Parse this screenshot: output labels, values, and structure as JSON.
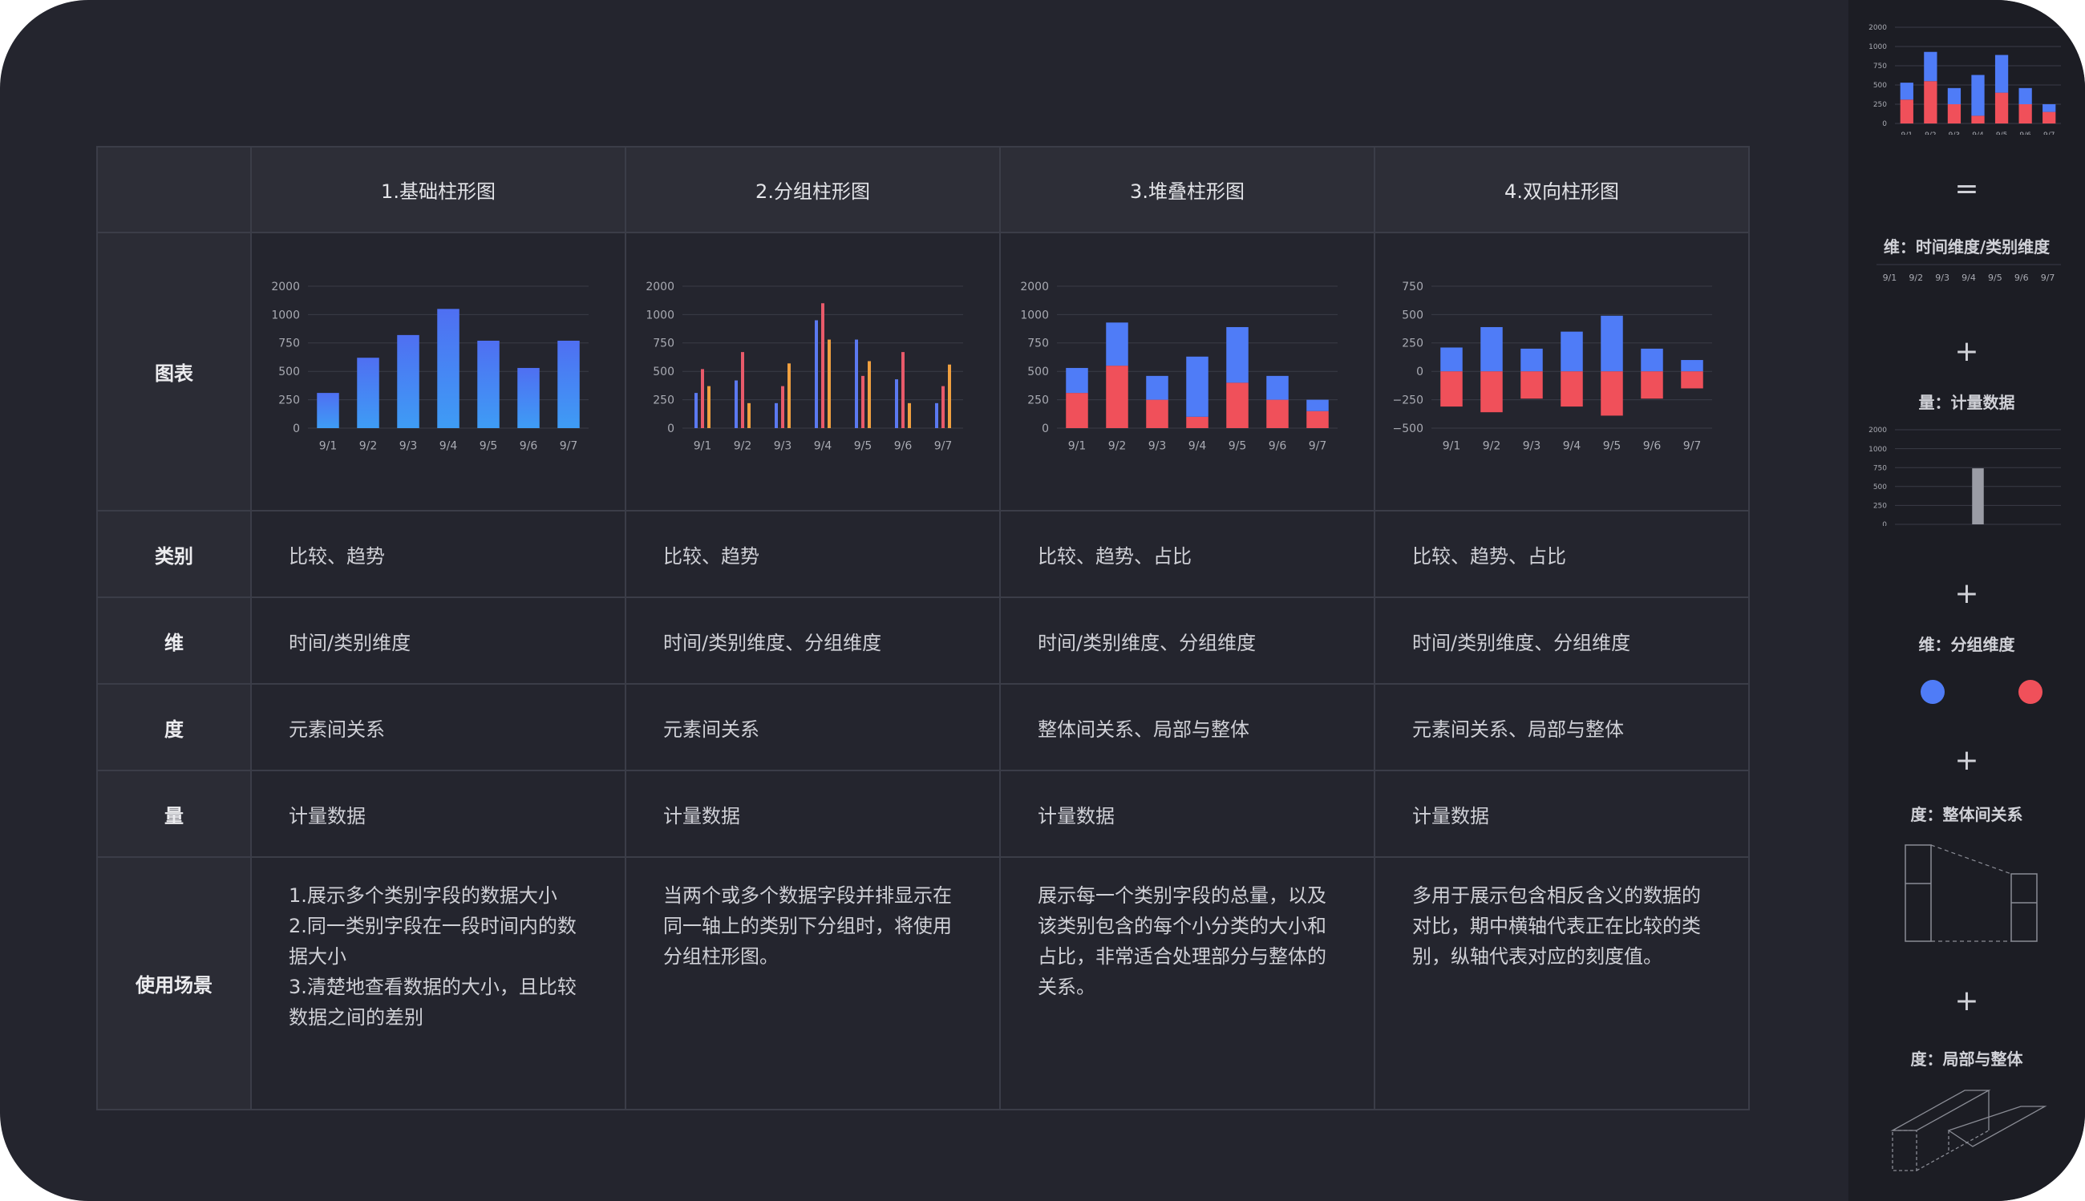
{
  "table": {
    "headers": [
      "",
      "1.基础柱形图",
      "2.分组柱形图",
      "3.堆叠柱形图",
      "4.双向柱形图"
    ],
    "row_labels": {
      "chart": "图表",
      "category": "类别",
      "dimension": "维",
      "measure": "度",
      "quantity": "量",
      "scene": "使用场景"
    },
    "category": [
      "比较、趋势",
      "比较、趋势",
      "比较、趋势、占比",
      "比较、趋势、占比"
    ],
    "dimension": [
      "时间/类别维度",
      "时间/类别维度、分组维度",
      "时间/类别维度、分组维度",
      "时间/类别维度、分组维度"
    ],
    "measure": [
      "元素间关系",
      "元素间关系",
      "整体间关系、局部与整体",
      "元素间关系、局部与整体"
    ],
    "quantity": [
      "计量数据",
      "计量数据",
      "计量数据",
      "计量数据"
    ],
    "scene": [
      [
        "1.展示多个类别字段的数据大小",
        "2.同一类别字段在一段时间内的数",
        "据大小",
        "3.清楚地查看数据的大小，且比较",
        "数据之间的差别"
      ],
      [
        "当两个或多个数据字段并排显示在",
        "同一轴上的类别下分组时，将使用",
        "分组柱形图。"
      ],
      [
        "展示每一个类别字段的总量，以及",
        "该类别包含的每个小分类的大小和",
        "占比，非常适合处理部分与整体的",
        "关系。"
      ],
      [
        "多用于展示包含相反含义的数据的",
        "对比，期中横轴代表正在比较的类",
        "别，纵轴代表对应的刻度值。"
      ]
    ]
  },
  "sidebar": {
    "equals": "=",
    "plus": "+",
    "dim_label": "维：时间维度/类别维度",
    "quantity_label": "量：计量数据",
    "group_label": "维：分组维度",
    "measure_whole_label": "度：整体间关系",
    "measure_part_label": "度：局部与整体",
    "colors": {
      "blue": "#4f7cf7",
      "red": "#f0505a"
    }
  },
  "chart_data": [
    {
      "type": "bar",
      "title": "1.基础柱形图",
      "categories": [
        "9/1",
        "9/2",
        "9/3",
        "9/4",
        "9/5",
        "9/6",
        "9/7"
      ],
      "yticks": [
        "0",
        "250",
        "500",
        "750",
        "1000",
        "2000"
      ],
      "values": [
        0.31,
        0.62,
        0.82,
        1.05,
        0.77,
        0.53,
        0.77
      ],
      "ylim": [
        0,
        1.25
      ]
    },
    {
      "type": "bar",
      "title": "2.分组柱形图",
      "categories": [
        "9/1",
        "9/2",
        "9/3",
        "9/4",
        "9/5",
        "9/6",
        "9/7"
      ],
      "yticks": [
        "0",
        "250",
        "500",
        "750",
        "1000",
        "2000"
      ],
      "series": [
        {
          "values": [
            0.31,
            0.42,
            0.22,
            0.95,
            0.78,
            0.43,
            0.22
          ],
          "color": "#5b79f0"
        },
        {
          "values": [
            0.52,
            0.67,
            0.37,
            1.1,
            0.46,
            0.67,
            0.37
          ],
          "color": "#e85a6a"
        },
        {
          "values": [
            0.37,
            0.22,
            0.57,
            0.78,
            0.59,
            0.22,
            0.56
          ],
          "color": "#f0a040"
        }
      ],
      "ylim": [
        0,
        1.25
      ]
    },
    {
      "type": "bar",
      "title": "3.堆叠柱形图",
      "categories": [
        "9/1",
        "9/2",
        "9/3",
        "9/4",
        "9/5",
        "9/6",
        "9/7"
      ],
      "yticks": [
        "0",
        "250",
        "500",
        "750",
        "1000",
        "2000"
      ],
      "series": [
        {
          "values": [
            0.31,
            0.55,
            0.25,
            0.1,
            0.4,
            0.25,
            0.15
          ],
          "color": "#f0505a"
        },
        {
          "values": [
            0.22,
            0.38,
            0.21,
            0.53,
            0.49,
            0.21,
            0.1
          ],
          "color": "#4f7cf7"
        }
      ],
      "ylim": [
        0,
        1.25
      ]
    },
    {
      "type": "bar",
      "title": "4.双向柱形图",
      "categories": [
        "9/1",
        "9/2",
        "9/3",
        "9/4",
        "9/5",
        "9/6",
        "9/7"
      ],
      "yticks": [
        "−500",
        "−250",
        "0",
        "250",
        "500",
        "750"
      ],
      "series": [
        {
          "values": [
            210,
            390,
            200,
            350,
            490,
            200,
            100
          ],
          "color": "#4f7cf7"
        },
        {
          "values": [
            -310,
            -360,
            -240,
            -310,
            -390,
            -240,
            -150
          ],
          "color": "#f0505a"
        }
      ],
      "ylim": [
        -500,
        750
      ]
    },
    {
      "type": "bar",
      "title": "sidebar-stacked",
      "categories": [
        "9/1",
        "9/2",
        "9/3",
        "9/4",
        "9/5",
        "9/6",
        "9/7"
      ],
      "yticks": [
        "0",
        "250",
        "500",
        "750",
        "1000",
        "2000"
      ],
      "series": [
        {
          "values": [
            0.31,
            0.55,
            0.25,
            0.1,
            0.4,
            0.25,
            0.15
          ],
          "color": "#f0505a"
        },
        {
          "values": [
            0.22,
            0.38,
            0.21,
            0.53,
            0.49,
            0.21,
            0.1
          ],
          "color": "#4f7cf7"
        }
      ],
      "ylim": [
        0,
        1.25
      ]
    },
    {
      "type": "bar",
      "title": "sidebar-quantity",
      "categories": [
        ""
      ],
      "yticks": [
        "0",
        "250",
        "500",
        "750",
        "1000",
        "2000"
      ],
      "values": [
        0.74
      ],
      "ylim": [
        0,
        1.25
      ]
    }
  ]
}
